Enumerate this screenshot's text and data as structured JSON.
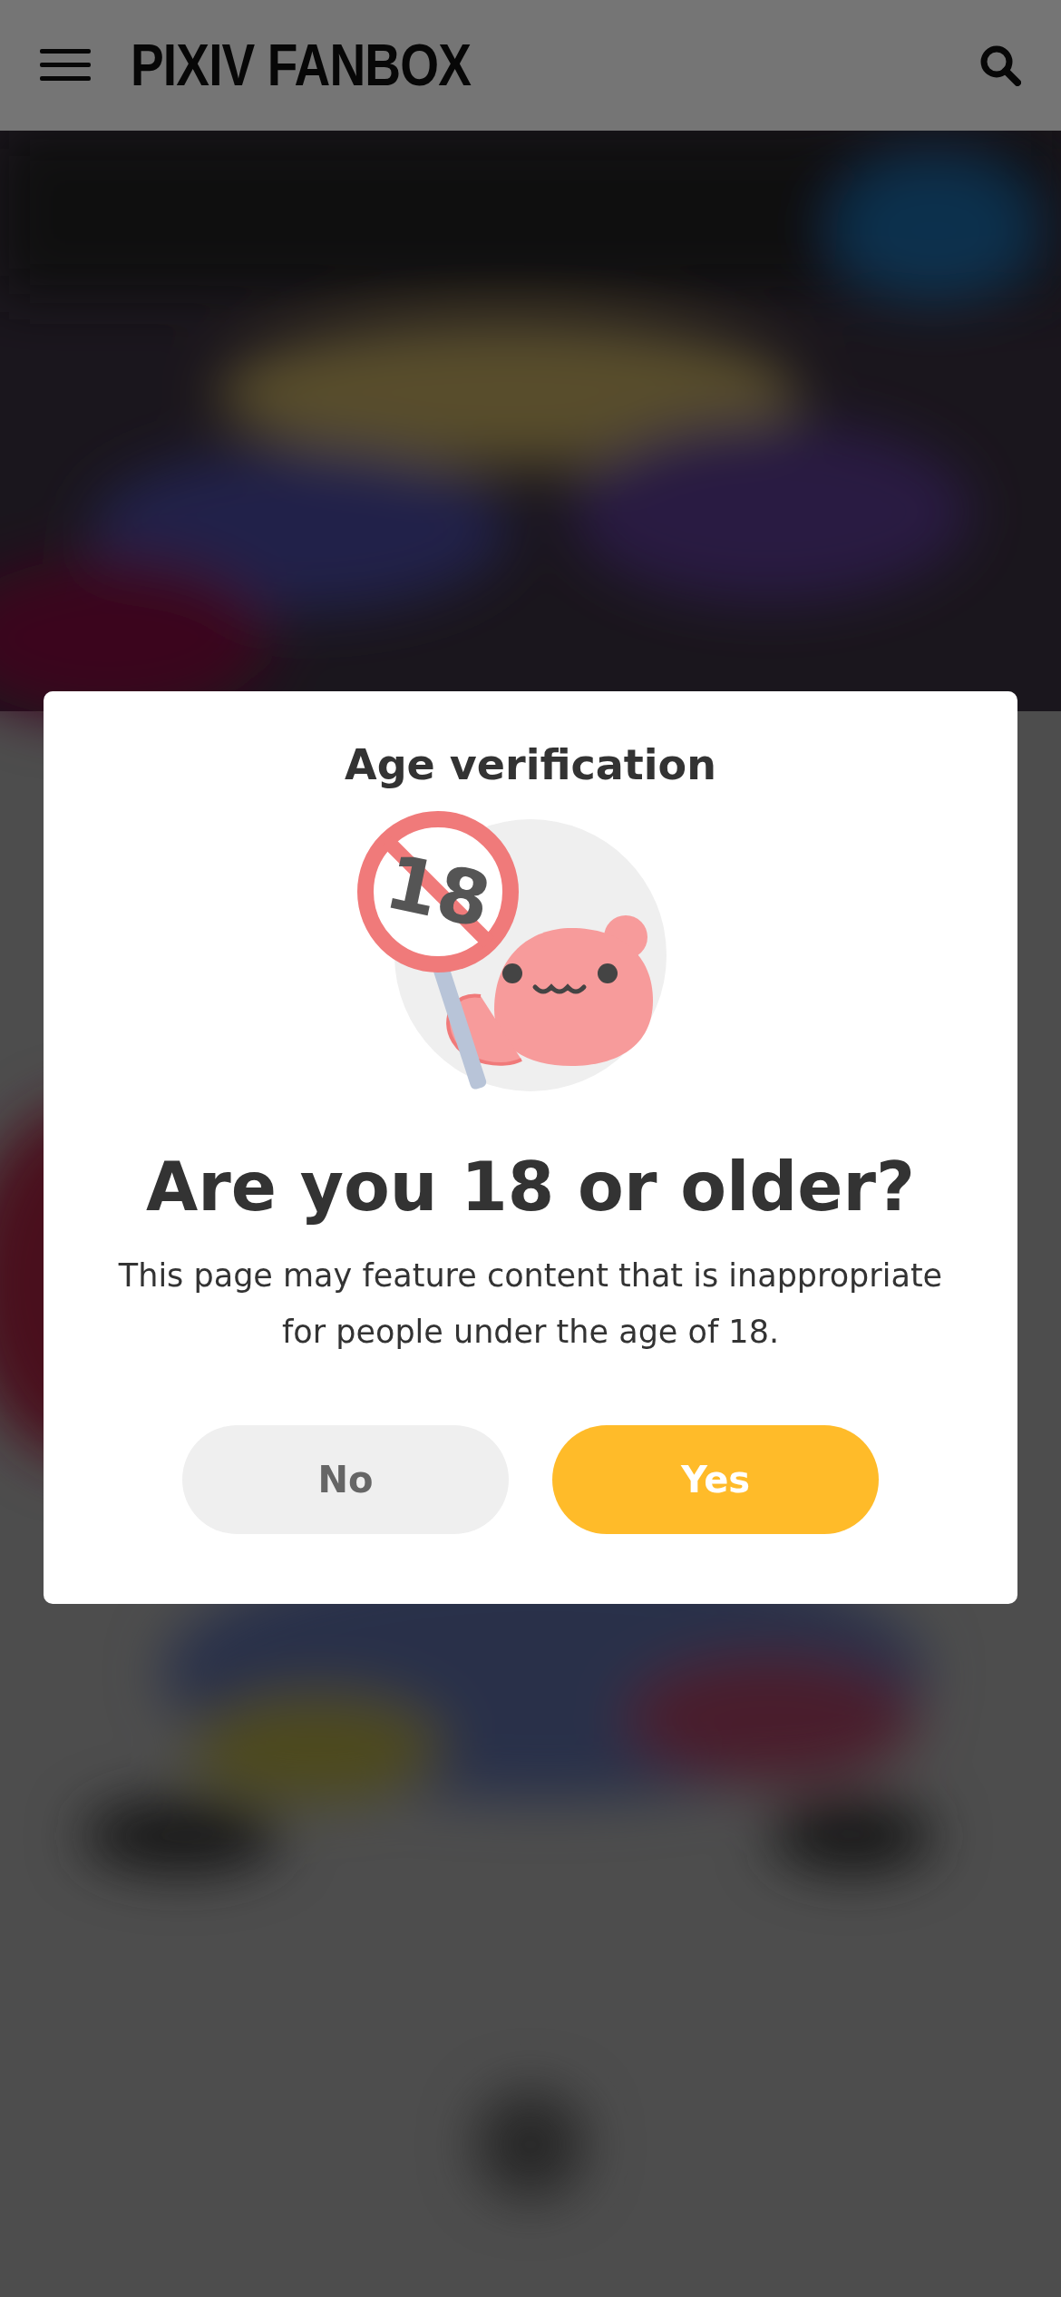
{
  "header": {
    "logo": "PIXIV FANBOX"
  },
  "dialog": {
    "title": "Age verification",
    "sign_text": "18",
    "heading": "Are you 18 or older?",
    "message": "This page may feature content that is inappropriate for people under the age of 18.",
    "buttons": [
      {
        "label": "No",
        "kind": "secondary"
      },
      {
        "label": "Yes",
        "kind": "primary"
      }
    ]
  }
}
